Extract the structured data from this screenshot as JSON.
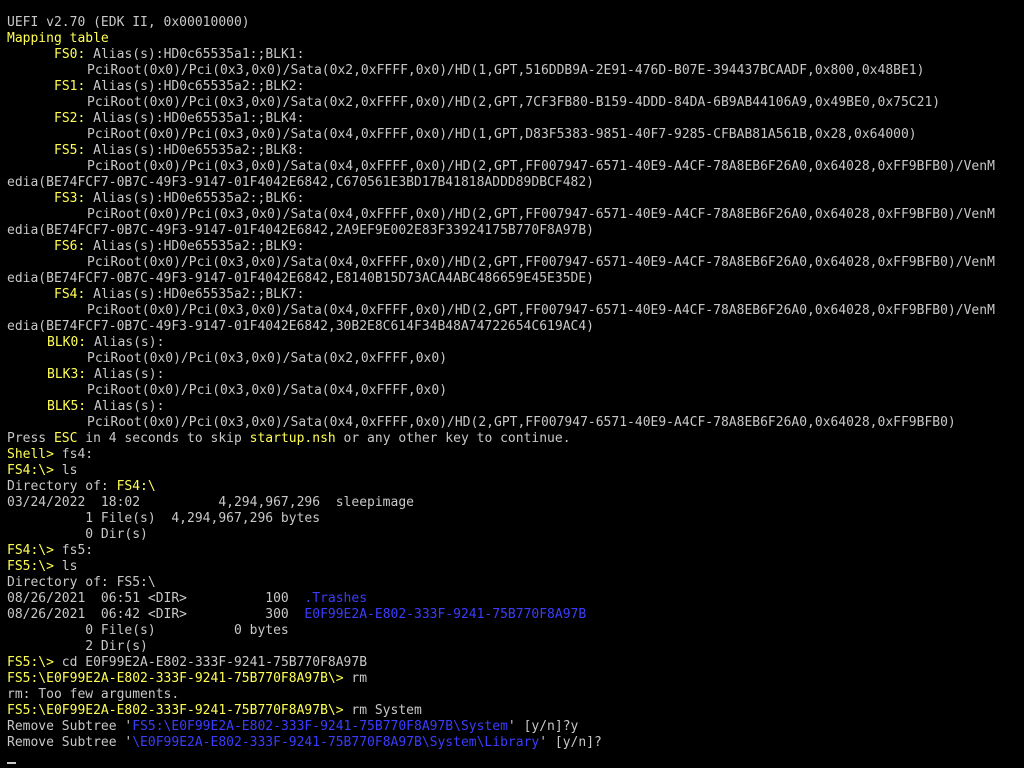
{
  "header": {
    "version": "UEFI v2.70 (EDK II, 0x00010000)",
    "mapping_title": "Mapping table"
  },
  "mapping": [
    {
      "dev": "FS0:",
      "alias": " Alias(s):HD0c65535a1:;BLK1:",
      "path": "PciRoot(0x0)/Pci(0x3,0x0)/Sata(0x2,0xFFFF,0x0)/HD(1,GPT,516DDB9A-2E91-476D-B07E-394437BCAADF,0x800,0x48BE1)",
      "cont": ""
    },
    {
      "dev": "FS1:",
      "alias": " Alias(s):HD0c65535a2:;BLK2:",
      "path": "PciRoot(0x0)/Pci(0x3,0x0)/Sata(0x2,0xFFFF,0x0)/HD(2,GPT,7CF3FB80-B159-4DDD-84DA-6B9AB44106A9,0x49BE0,0x75C21)",
      "cont": ""
    },
    {
      "dev": "FS2:",
      "alias": " Alias(s):HD0e65535a1:;BLK4:",
      "path": "PciRoot(0x0)/Pci(0x3,0x0)/Sata(0x4,0xFFFF,0x0)/HD(1,GPT,D83F5383-9851-40F7-9285-CFBAB81A561B,0x28,0x64000)",
      "cont": ""
    },
    {
      "dev": "FS5:",
      "alias": " Alias(s):HD0e65535a2:;BLK8:",
      "path": "PciRoot(0x0)/Pci(0x3,0x0)/Sata(0x4,0xFFFF,0x0)/HD(2,GPT,FF007947-6571-40E9-A4CF-78A8EB6F26A0,0x64028,0xFF9BFB0)/VenM",
      "cont": "edia(BE74FCF7-0B7C-49F3-9147-01F4042E6842,C670561E3BD17B41818ADDD89DBCF482)"
    },
    {
      "dev": "FS3:",
      "alias": " Alias(s):HD0e65535a2:;BLK6:",
      "path": "PciRoot(0x0)/Pci(0x3,0x0)/Sata(0x4,0xFFFF,0x0)/HD(2,GPT,FF007947-6571-40E9-A4CF-78A8EB6F26A0,0x64028,0xFF9BFB0)/VenM",
      "cont": "edia(BE74FCF7-0B7C-49F3-9147-01F4042E6842,2A9EF9E002E83F33924175B770F8A97B)"
    },
    {
      "dev": "FS6:",
      "alias": " Alias(s):HD0e65535a2:;BLK9:",
      "path": "PciRoot(0x0)/Pci(0x3,0x0)/Sata(0x4,0xFFFF,0x0)/HD(2,GPT,FF007947-6571-40E9-A4CF-78A8EB6F26A0,0x64028,0xFF9BFB0)/VenM",
      "cont": "edia(BE74FCF7-0B7C-49F3-9147-01F4042E6842,E8140B15D73ACA4ABC486659E45E35DE)"
    },
    {
      "dev": "FS4:",
      "alias": " Alias(s):HD0e65535a2:;BLK7:",
      "path": "PciRoot(0x0)/Pci(0x3,0x0)/Sata(0x4,0xFFFF,0x0)/HD(2,GPT,FF007947-6571-40E9-A4CF-78A8EB6F26A0,0x64028,0xFF9BFB0)/VenM",
      "cont": "edia(BE74FCF7-0B7C-49F3-9147-01F4042E6842,30B2E8C614F34B48A74722654C619AC4)"
    },
    {
      "dev": "BLK0:",
      "alias": " Alias(s):",
      "path": "PciRoot(0x0)/Pci(0x3,0x0)/Sata(0x2,0xFFFF,0x0)",
      "cont": ""
    },
    {
      "dev": "BLK3:",
      "alias": " Alias(s):",
      "path": "PciRoot(0x0)/Pci(0x3,0x0)/Sata(0x4,0xFFFF,0x0)",
      "cont": ""
    },
    {
      "dev": "BLK5:",
      "alias": " Alias(s):",
      "path": "PciRoot(0x0)/Pci(0x3,0x0)/Sata(0x4,0xFFFF,0x0)/HD(2,GPT,FF007947-6571-40E9-A4CF-78A8EB6F26A0,0x64028,0xFF9BFB0)",
      "cont": ""
    }
  ],
  "startup": {
    "pre": "Press ",
    "esc": "ESC",
    "mid": " in 4 seconds to skip ",
    "file": "startup.nsh",
    "post": " or any other key to continue."
  },
  "session": {
    "shell_prompt": "Shell>",
    "cmd_fs4": " fs4:",
    "fs4_prompt": "FS4:\\>",
    "cmd_ls": " ls",
    "dir_of_label": "Directory of: ",
    "fs4_path": "FS4:\\",
    "fs4_entry": "03/24/2022  18:02          4,294,967,296  sleepimage",
    "fs4_files": "          1 File(s)  4,294,967,296 bytes",
    "fs4_dirs": "          0 Dir(s)",
    "cmd_fs5": " fs5:",
    "fs5_prompt": "FS5:\\>",
    "fs5_path": "FS5:\\",
    "fs5_entry1_meta": "08/26/2021  06:51 <DIR>          100  ",
    "fs5_entry1_name": ".Trashes",
    "fs5_entry2_meta": "08/26/2021  06:42 <DIR>          300  ",
    "fs5_entry2_name": "E0F99E2A-E802-333F-9241-75B770F8A97B",
    "fs5_files": "          0 File(s)          0 bytes",
    "fs5_dirs": "          2 Dir(s)",
    "cmd_cd": " cd E0F99E2A-E802-333F-9241-75B770F8A97B",
    "sub_prompt": "FS5:\\E0F99E2A-E802-333F-9241-75B770F8A97B\\>",
    "cmd_rm": " rm",
    "rm_error": "rm: Too few arguments.",
    "cmd_rm_system": " rm System",
    "remove1_pre": "Remove Subtree '",
    "remove1_path": "FS5:\\E0F99E2A-E802-333F-9241-75B770F8A97B\\System",
    "remove1_post": "' [y/n]?y",
    "remove2_pre": "Remove Subtree '",
    "remove2_path": "\\E0F99E2A-E802-333F-9241-75B770F8A97B\\System\\Library",
    "remove2_post": "' [y/n]?"
  },
  "colors": {
    "background": "#000000",
    "text": "#c8c8c8",
    "highlight": "#ffff55",
    "link": "#3c3cff"
  }
}
